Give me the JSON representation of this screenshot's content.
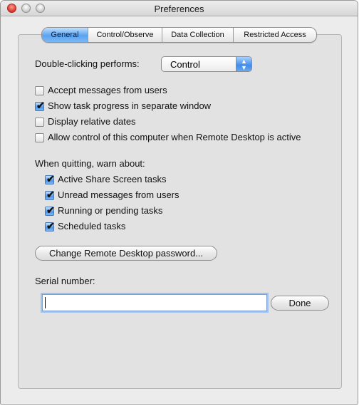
{
  "window": {
    "title": "Preferences"
  },
  "tabs": [
    {
      "label": "General",
      "selected": true
    },
    {
      "label": "Control/Observe",
      "selected": false
    },
    {
      "label": "Data Collection",
      "selected": false
    },
    {
      "label": "Restricted Access",
      "selected": false
    }
  ],
  "general": {
    "double_click_label": "Double-clicking performs:",
    "double_click_value": "Control",
    "checkboxes": [
      {
        "label": "Accept messages from users",
        "checked": false
      },
      {
        "label": "Show task progress in separate window",
        "checked": true
      },
      {
        "label": "Display relative dates",
        "checked": false
      },
      {
        "label": "Allow control of this computer when Remote Desktop is active",
        "checked": false
      }
    ],
    "quit_warn_label": "When quitting, warn about:",
    "quit_warn_items": [
      {
        "label": "Active Share Screen tasks",
        "checked": true
      },
      {
        "label": "Unread messages from users",
        "checked": true
      },
      {
        "label": "Running or pending tasks",
        "checked": true
      },
      {
        "label": "Scheduled tasks",
        "checked": true
      }
    ],
    "change_password_button": "Change Remote Desktop password...",
    "serial_label": "Serial number:",
    "serial_value": "",
    "done_button": "Done"
  },
  "colors": {
    "accent": "#5aa3ef",
    "window_bg": "#ececec",
    "panel_bg": "#e2e2e2"
  },
  "icons": {
    "check": "✔",
    "popup_arrows": "▲▼"
  }
}
